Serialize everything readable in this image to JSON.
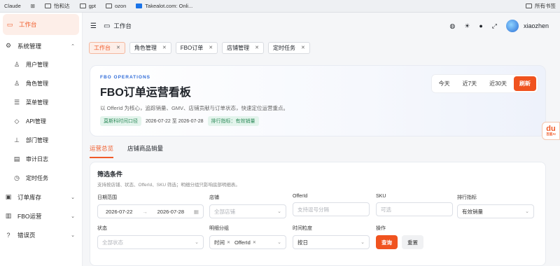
{
  "bookmarks": {
    "items": [
      {
        "icon": "app-icon",
        "label": "Claude"
      },
      {
        "icon": "grid-icon",
        "label": ""
      },
      {
        "icon": "folder-icon",
        "label": "怡和达"
      },
      {
        "icon": "folder-icon",
        "label": "gpt"
      },
      {
        "icon": "folder-icon",
        "label": "ozon"
      },
      {
        "icon": "takealot-icon",
        "label": "Takealot.com: Onli..."
      }
    ],
    "all_label": "所有书签"
  },
  "sidebar": {
    "items": [
      {
        "icon": "monitor-icon",
        "label": "工作台",
        "active": true
      },
      {
        "icon": "gear-icon",
        "label": "系统管理",
        "expanded": true
      },
      {
        "icon": "user-icon",
        "label": "用户管理",
        "sub": true
      },
      {
        "icon": "users-icon",
        "label": "角色管理",
        "sub": true
      },
      {
        "icon": "menu-icon",
        "label": "菜单管理",
        "sub": true
      },
      {
        "icon": "api-icon",
        "label": "API管理",
        "sub": true
      },
      {
        "icon": "org-icon",
        "label": "部门管理",
        "sub": true
      },
      {
        "icon": "log-icon",
        "label": "审计日志",
        "sub": true
      },
      {
        "icon": "clock-icon",
        "label": "定时任务",
        "sub": true
      },
      {
        "icon": "box-icon",
        "label": "订单库存",
        "expanded": false
      },
      {
        "icon": "chart-icon",
        "label": "FBO运营",
        "expanded": false
      },
      {
        "icon": "help-icon",
        "label": "错误页",
        "expanded": false
      }
    ]
  },
  "header": {
    "title": "工作台",
    "username": "xiaozhen"
  },
  "tabs": [
    {
      "label": "工作台",
      "active": true
    },
    {
      "label": "角色管理",
      "active": false
    },
    {
      "label": "FBO订单",
      "active": false
    },
    {
      "label": "店铺管理",
      "active": false
    },
    {
      "label": "定时任务",
      "active": false
    }
  ],
  "hero": {
    "kicker": "FBO OPERATIONS",
    "title": "FBO订单运营看板",
    "description": "以 OfferId 为核心，追踪销量、GMV、店铺贡献与订单状态，快速定位运营重点。",
    "chip_timezone": "莫斯科时间口径",
    "date_range": "2026-07-22 至 2026-07-28",
    "chip_metric": "排行指标：有效销量",
    "range_buttons": [
      "今天",
      "近7天",
      "近30天"
    ],
    "refresh_label": "刷新"
  },
  "page_tabs": [
    {
      "label": "运营总览",
      "active": true
    },
    {
      "label": "店铺商品销量",
      "active": false
    }
  ],
  "filter": {
    "title": "筛选条件",
    "hint": "支持按店铺、状态、OfferId、SKU 筛选；明细分组只影响底部明细表。",
    "date_label": "日期范围",
    "date_start": "2026-07-22",
    "date_end": "2026-07-28",
    "store_label": "店铺",
    "store_placeholder": "全部店铺",
    "offer_label": "OfferId",
    "offer_placeholder": "支持逗号分隔",
    "sku_label": "SKU",
    "sku_placeholder": "可选",
    "rank_label": "排行指标",
    "rank_value": "有效销量",
    "status_label": "状态",
    "status_placeholder": "全部状态",
    "group_label": "明细分组",
    "group_tags": [
      "时间",
      "OfferId"
    ],
    "granularity_label": "时间粒度",
    "granularity_value": "按日",
    "action_label": "操作",
    "query_label": "查询",
    "reset_label": "重置"
  },
  "float_widget": {
    "label": "百度AI",
    "glyph": "du"
  }
}
